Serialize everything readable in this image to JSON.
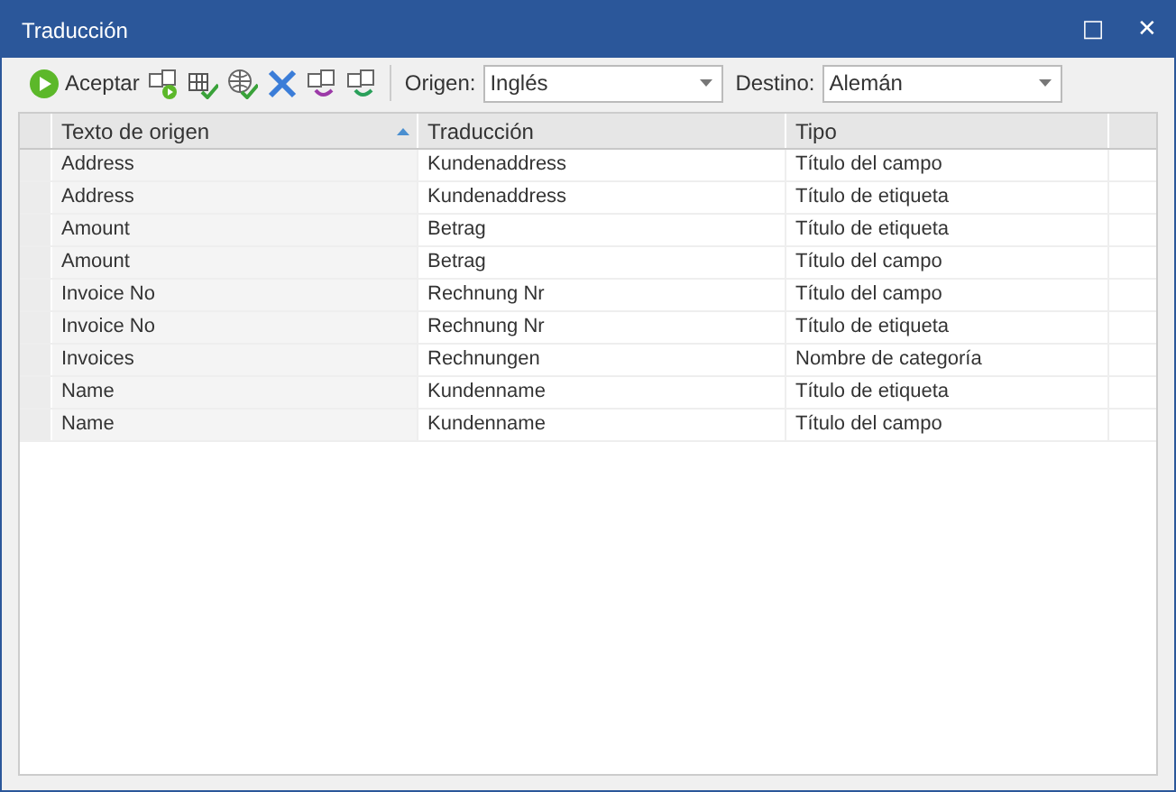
{
  "window": {
    "title": "Traducción",
    "buttons": [
      "□",
      "✕"
    ]
  },
  "toolbar": {
    "accept_label": "Aceptar",
    "source_label": "Origen:",
    "source_value": "Inglés",
    "target_label": "Destino:",
    "target_value": "Alemán"
  },
  "table": {
    "columns": [
      {
        "label": "Texto de origen",
        "sorted": true
      },
      {
        "label": "Traducción",
        "sorted": false
      },
      {
        "label": "Tipo",
        "sorted": false
      }
    ],
    "rows": [
      [
        "Address",
        "Kundenaddress",
        "Título del campo"
      ],
      [
        "Address",
        "Kundenaddress",
        "Título de etiqueta"
      ],
      [
        "Amount",
        "Betrag",
        "Título de etiqueta"
      ],
      [
        "Amount",
        "Betrag",
        "Título del campo"
      ],
      [
        "Invoice No",
        "Rechnung Nr",
        "Título del campo"
      ],
      [
        "Invoice No",
        "Rechnung Nr",
        "Título de etiqueta"
      ],
      [
        "Invoices",
        "Rechnungen",
        "Nombre de categoría"
      ],
      [
        "Name",
        "Kundenname",
        "Título de etiqueta"
      ],
      [
        "Name",
        "Kundenname",
        "Título del campo"
      ]
    ]
  }
}
